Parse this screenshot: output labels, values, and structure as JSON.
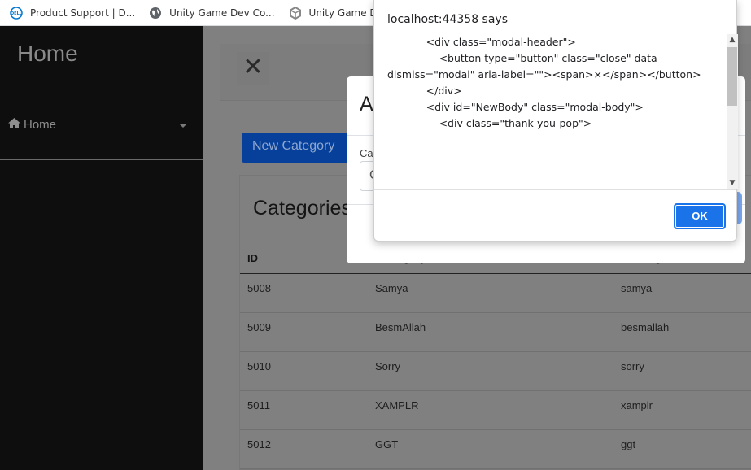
{
  "bookmarks": [
    {
      "icon": "dell-logo-icon",
      "label": "Product Support | D..."
    },
    {
      "icon": "globe-icon",
      "label": "Unity Game Dev Co..."
    },
    {
      "icon": "unity-logo-icon",
      "label": "Unity Game Dev Co..."
    }
  ],
  "sidebar": {
    "title": "Home",
    "items": [
      {
        "icon": "home-icon",
        "label": "Home"
      }
    ]
  },
  "main": {
    "new_category_label": "New Category",
    "card_title": "Categories",
    "table": {
      "sort_indicator": "↓",
      "columns": [
        "ID",
        "Category",
        "Url Slug"
      ],
      "rows": [
        [
          "5008",
          "Samya",
          "samya"
        ],
        [
          "5009",
          "BesmAllah",
          "besmallah"
        ],
        [
          "5010",
          "Sorry",
          "sorry"
        ],
        [
          "5011",
          "XAMPLR",
          "xamplr"
        ],
        [
          "5012",
          "GGT",
          "ggt"
        ]
      ]
    }
  },
  "bs_modal": {
    "title": "A",
    "field_label": "Ca",
    "field_value": "C"
  },
  "alert": {
    "origin": "localhost:44358 says",
    "message_lines": [
      "",
      "",
      "            <div class=\"modal-header\">",
      "                <button type=\"button\" class=\"close\" data-",
      "dismiss=\"modal\" aria-label=\"\"><span>×</span></button>",
      "            </div>",
      "",
      "            <div id=\"NewBody\" class=\"modal-body\">",
      "",
      "                <div class=\"thank-you-pop\">"
    ],
    "ok_label": "OK"
  }
}
